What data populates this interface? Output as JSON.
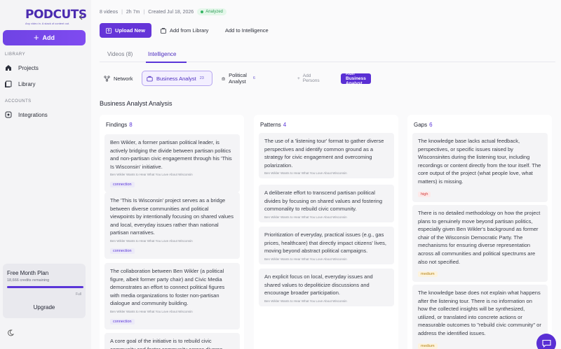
{
  "brand": {
    "name": "PODCUTS",
    "tagline": "Any video in. A stack of content out."
  },
  "sidebar": {
    "add_label": "Add",
    "library_label": "LIBRARY",
    "accounts_label": "ACCOUNTS",
    "items": [
      {
        "label": "Projects",
        "icon": "home-icon"
      },
      {
        "label": "Library",
        "icon": "library-icon"
      },
      {
        "label": "Integrations",
        "icon": "integrations-icon"
      }
    ],
    "plan": {
      "title": "Free Month Plan",
      "credits": "18,666 credits remaining",
      "fill": 1.0,
      "status": "Full",
      "upgrade": "Upgrade"
    }
  },
  "meta": {
    "videos": "8 videos",
    "duration": "2h 7m",
    "created": "Created Jul 18, 2026",
    "status": "Analyzed"
  },
  "actions": {
    "upload": "Upload New",
    "add_library": "Add from Library",
    "add_intelligence": "Add to Intelligence"
  },
  "tabs": [
    {
      "label": "Videos (8)"
    },
    {
      "label": "Intelligence"
    }
  ],
  "personas": {
    "network": "Network",
    "business": {
      "label": "Business Analyst",
      "count": "23"
    },
    "political": {
      "label": "Political Analyst",
      "count": "6"
    },
    "add_persons": "Add Persons",
    "run": "Run Business Analyst"
  },
  "analysis_title": "Business Analyst Analysis",
  "source_title": "Ben Wikler Wants to Hear What You Love About Wisconsin",
  "columns": {
    "findings": {
      "title": "Findings",
      "count": "8",
      "cards": [
        {
          "text": "Ben Wikler, a former partisan political leader, is actively bridging the divide between partisan politics and non-partisan civic engagement through his 'This Is Wisconsin' initiative.",
          "tag": "connection"
        },
        {
          "text": "The 'This Is Wisconsin' project serves as a bridge between diverse communities and political viewpoints by intentionally focusing on shared values and local, everyday issues rather than national partisan narratives.",
          "tag": "connection"
        },
        {
          "text": "The collaboration between Ben Wikler (a political figure, albeit former party chair) and Civic Media demonstrates an effort to connect political figures with media organizations to foster non-partisan dialogue and community building.",
          "tag": "connection"
        },
        {
          "text": "A core goal of the initiative is to rebuild civic community and foster community across diverse",
          "tag": ""
        }
      ]
    },
    "patterns": {
      "title": "Patterns",
      "count": "4",
      "cards": [
        {
          "text": "The use of a 'listening tour' format to gather diverse perspectives and identify common ground as a strategy for civic engagement and overcoming polarization."
        },
        {
          "text": "A deliberate effort to transcend partisan political divides by focusing on shared values and fostering commonality to rebuild civic community."
        },
        {
          "text": "Prioritization of everyday, practical issues (e.g., gas prices, healthcare) that directly impact citizens' lives, moving beyond abstract political campaigns."
        },
        {
          "text": "An explicit focus on local, everyday issues and shared values to depoliticize discussions and encourage broader participation."
        }
      ]
    },
    "gaps": {
      "title": "Gaps",
      "count": "6",
      "cards": [
        {
          "text": "The knowledge base lacks actual feedback, perspectives, or specific issues raised by Wisconsinites during the listening tour, including recordings or content directly from the tour itself. The core output of the project (what people love, what matters) is missing.",
          "tag": "high"
        },
        {
          "text": "There is no detailed methodology on how the project plans to genuinely move beyond partisan politics, especially given Ben Wikler's background as former chair of the Wisconsin Democratic Party. The mechanisms for ensuring diverse representation across all communities and political spectrums are also not specified.",
          "tag": "medium"
        },
        {
          "text": "The knowledge base does not explain what happens after the listening tour. There is no information on how the collected insights will be synthesized, utilized, or translated into concrete actions or measurable outcomes to \"rebuild civic community\" or address the identified issues.",
          "tag": "medium"
        }
      ]
    }
  },
  "colors": {
    "accent": "#5a35d8",
    "success": "#34b463"
  }
}
